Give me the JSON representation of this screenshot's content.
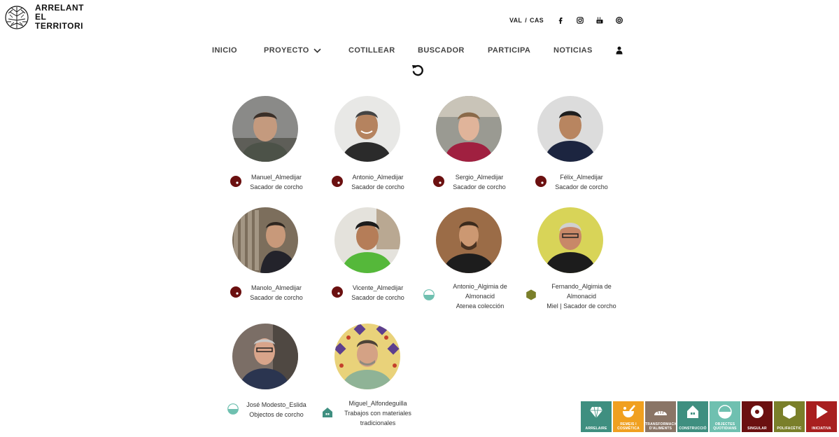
{
  "brand": {
    "line1": "ARRELANT",
    "line2": "EL",
    "line3": "TERRITORI"
  },
  "topbar": {
    "lang_val": "VAL",
    "lang_sep": "/",
    "lang_cas": "CAS",
    "social": [
      "facebook-icon",
      "instagram-icon",
      "youtube-icon",
      "vimeo-icon"
    ]
  },
  "nav": {
    "inicio": "INICIO",
    "proyecto": "PROYECTO",
    "cotillear": "COTILLEAR",
    "buscador": "BUSCADOR",
    "participa": "PARTICIPA",
    "noticias": "NOTICIAS"
  },
  "people": [
    {
      "name": "Manuel_Almedijar",
      "lines": [
        "Sacador de corcho"
      ],
      "category": "singular"
    },
    {
      "name": "Antonio_Almedijar",
      "lines": [
        "Sacador de corcho"
      ],
      "category": "singular"
    },
    {
      "name": "Sergio_Almedijar",
      "lines": [
        "Sacador de corcho"
      ],
      "category": "singular"
    },
    {
      "name": "Félix_Almedijar",
      "lines": [
        "Sacador de corcho"
      ],
      "category": "singular"
    },
    {
      "name": "Manolo_Almedijar",
      "lines": [
        "Sacador de corcho"
      ],
      "category": "singular"
    },
    {
      "name": "Vicente_Almedijar",
      "lines": [
        "Sacador de corcho"
      ],
      "category": "singular"
    },
    {
      "name": "Antonio_Algimia de",
      "lines": [
        "Almonacid",
        "Atenea colección"
      ],
      "category": "objectes"
    },
    {
      "name": "Fernando_Algimia de",
      "lines": [
        "Almonacid",
        "Miel | Sacador de corcho"
      ],
      "category": "polifacetic"
    },
    {
      "name": "José Modesto_Eslida",
      "lines": [
        "Objectos de corcho"
      ],
      "category": "objectes"
    },
    {
      "name": "Miguel_Alfondeguilla",
      "lines": [
        "Trabajos con materiales",
        "tradicionales"
      ],
      "category": "construccio"
    }
  ],
  "legend": [
    {
      "label1": "ARRELAIRE",
      "label2": "",
      "color": "#3f8f80",
      "icon": "diamond-icon"
    },
    {
      "label1": "REMEIS I",
      "label2": "COSMÈTICA",
      "color": "#f0a020",
      "icon": "mortar-icon"
    },
    {
      "label1": "TRANSFORMACIÓ",
      "label2": "D'ALIMENTS",
      "color": "#8a7566",
      "icon": "bread-icon"
    },
    {
      "label1": "CONSTRUCCIÓ",
      "label2": "",
      "color": "#3f8f80",
      "icon": "house-icon"
    },
    {
      "label1": "OBJECTES",
      "label2": "QUOTIDIANS",
      "color": "#6fc0b0",
      "icon": "half-circle-icon"
    },
    {
      "label1": "SINGULAR",
      "label2": "",
      "color": "#6b1010",
      "icon": "dot-circle-icon"
    },
    {
      "label1": "POLIFACÈTIC",
      "label2": "",
      "color": "#7a7f2a",
      "icon": "hexagon-icon"
    },
    {
      "label1": "INICIATIVA",
      "label2": "",
      "color": "#a81f1f",
      "icon": "play-icon"
    }
  ],
  "colors": {
    "singular": "#6b1010",
    "objectes": "#6fc0b0",
    "polifacetic": "#7a7f2a",
    "construccio": "#3f8f80"
  }
}
